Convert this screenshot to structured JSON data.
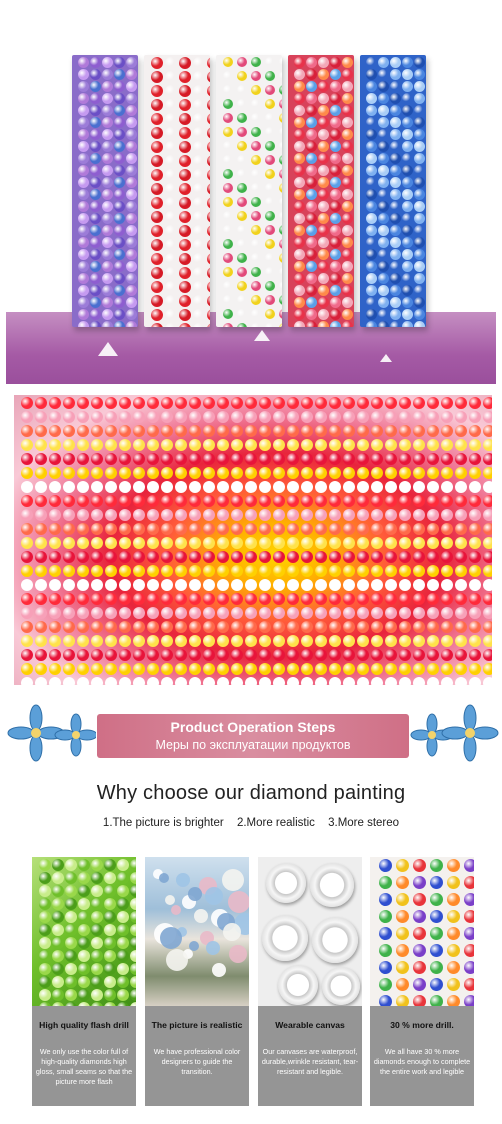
{
  "banner": {
    "title": "Product Operation Steps",
    "subtitle": "Меры по эксплуатации продуктов"
  },
  "heading": "Why  choose our diamond painting",
  "benefits": [
    "1.The picture is brighter",
    "2.More realistic",
    "3.More stereo"
  ],
  "cards": [
    {
      "title": "High quality flash drill",
      "desc": "We only use the color full of high-quality diamonds high gloss, small seams so that the picture more flash"
    },
    {
      "title": "The picture is realistic",
      "desc": "We have professional color designers to guide the transition."
    },
    {
      "title": "Wearable canvas",
      "desc": "Our canvases are waterproof, durable,wrinkle resistant, tear-resistant and legible."
    },
    {
      "title": "30 % more drill.",
      "desc": "We all have 30 % more diamonds enough to complete the entire work and legible"
    }
  ],
  "colors": {
    "banner": "#d98ea0",
    "card_bg": "#959595",
    "floor": "#a55aa5"
  }
}
